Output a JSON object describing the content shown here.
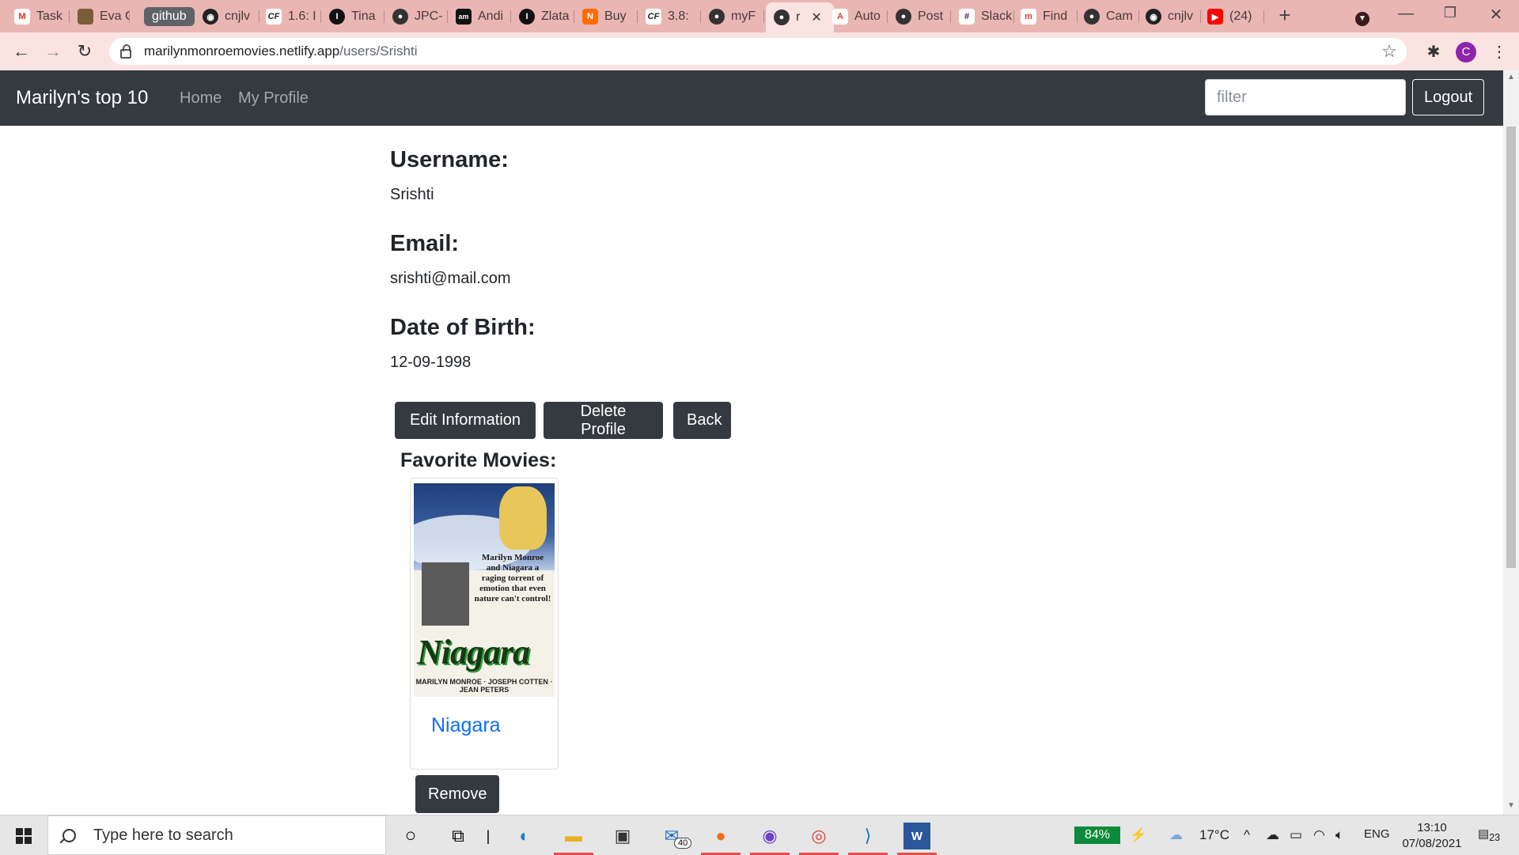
{
  "browser": {
    "tabs": [
      {
        "label": "Task",
        "icon": "gmail-icon",
        "color": "#d93025"
      },
      {
        "label": "Eva C",
        "icon": "profile-photo-icon",
        "color": "#7a5c3a"
      },
      {
        "label": "cnjlv",
        "icon": "github-icon",
        "color": "#222222"
      },
      {
        "label": "1.6: I",
        "icon": "cf-icon",
        "color": "#222222"
      },
      {
        "label": "Tina",
        "icon": "medium-icon",
        "color": "#111111"
      },
      {
        "label": "JPC-",
        "icon": "globe-icon",
        "color": "#333333"
      },
      {
        "label": "Andi",
        "icon": "am-icon",
        "color": "#111111"
      },
      {
        "label": "Zlata",
        "icon": "medium-icon",
        "color": "#111111"
      },
      {
        "label": "Buy",
        "icon": "bolt-icon",
        "color": "#ff6d00"
      },
      {
        "label": "3.8:",
        "icon": "cf-icon",
        "color": "#222222"
      },
      {
        "label": "myF",
        "icon": "globe-icon",
        "color": "#333333"
      },
      {
        "label": "r",
        "icon": "globe-icon",
        "color": "#333333"
      },
      {
        "label": "Auto",
        "icon": "acrobat-icon",
        "color": "#e53935"
      },
      {
        "label": "Post",
        "icon": "globe-icon",
        "color": "#333333"
      },
      {
        "label": "Slack",
        "icon": "slack-icon",
        "color": "#4a154b"
      },
      {
        "label": "Find",
        "icon": "m-icon",
        "color": "#e53935"
      },
      {
        "label": "Cam",
        "icon": "globe-icon",
        "color": "#333333"
      },
      {
        "label": "cnjlv",
        "icon": "github-icon",
        "color": "#222222"
      },
      {
        "label": "(24)",
        "icon": "youtube-icon",
        "color": "#ff0000"
      }
    ],
    "tab_group_label": "github",
    "url_host": "marilynmonroemovies.netlify.app",
    "url_path": "/users/Srishti",
    "profile_initial": "C"
  },
  "navbar": {
    "brand": "Marilyn's top 10",
    "links": [
      "Home",
      "My Profile"
    ],
    "filter_placeholder": "filter",
    "logout_label": "Logout"
  },
  "profile": {
    "username_label": "Username:",
    "username": "Srishti",
    "email_label": "Email:",
    "email": "srishti@mail.com",
    "dob_label": "Date of Birth:",
    "dob": "12-09-1998",
    "buttons": {
      "edit": "Edit Information",
      "delete": "Delete Profile",
      "back": "Back"
    },
    "favorites_label": "Favorite Movies:",
    "favorites": [
      {
        "title": "Niagara",
        "remove_label": "Remove"
      }
    ]
  },
  "taskbar": {
    "search_placeholder": "Type here to search",
    "mail_badge": "40",
    "battery": "84%",
    "temperature": "17°C",
    "language": "ENG",
    "time": "13:10",
    "date": "07/08/2021",
    "notifications": "23"
  }
}
